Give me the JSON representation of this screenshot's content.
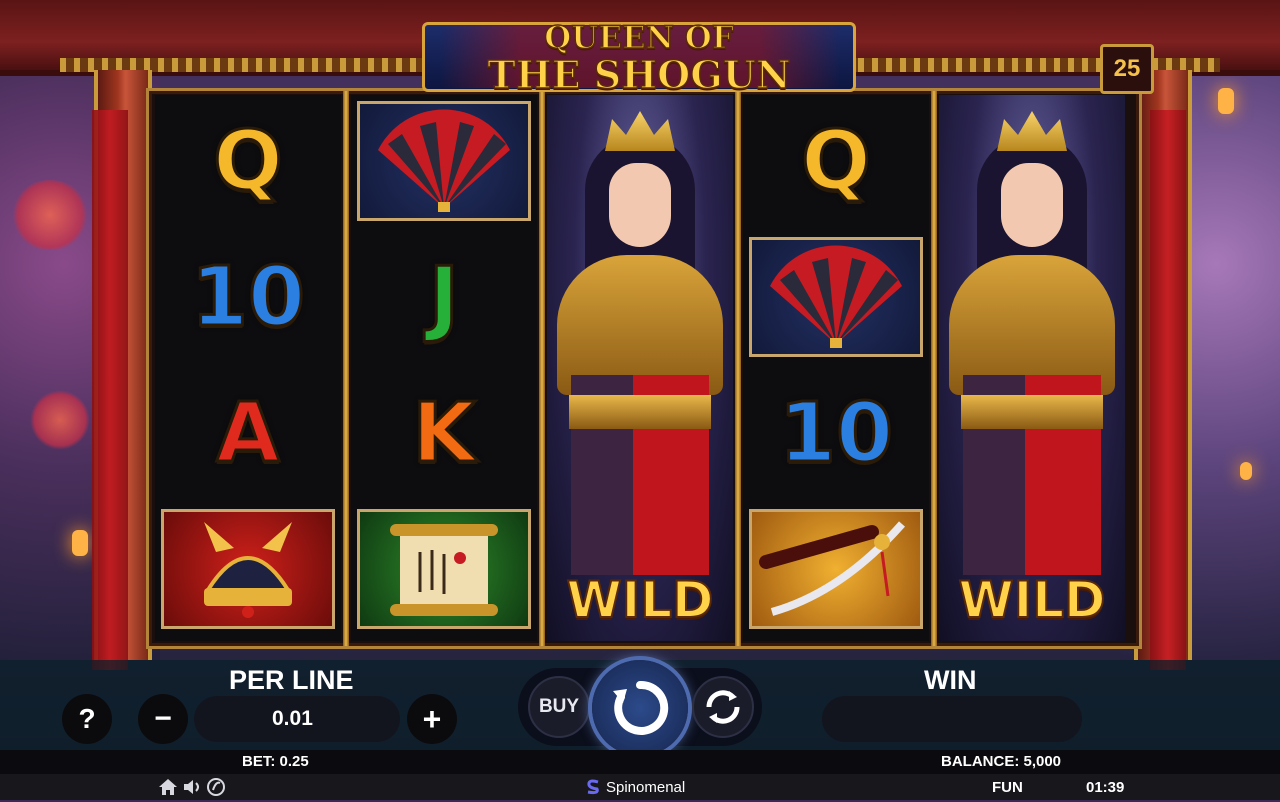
{
  "game": {
    "title_line1": "QUEEN OF",
    "title_line2": "THE SHOGUN",
    "lines_count": "25"
  },
  "reels": [
    [
      "Q",
      "10",
      "A",
      "samurai-helmet"
    ],
    [
      "fan",
      "J",
      "K",
      "scroll"
    ],
    [
      "queen-wild"
    ],
    [
      "Q",
      "fan",
      "10",
      "sword"
    ],
    [
      "queen-wild"
    ]
  ],
  "wild_label": "WILD",
  "controls": {
    "help_label": "?",
    "per_line_label": "PER LINE",
    "per_line_value": "0.01",
    "minus_label": "−",
    "plus_label": "+",
    "buy_label": "BUY",
    "win_label": "WIN",
    "win_value": ""
  },
  "status": {
    "bet_text": "BET: 0.25",
    "balance_text": "BALANCE: 5,000"
  },
  "footer": {
    "brand": "Spinomenal",
    "mode": "FUN",
    "clock": "01:39",
    "icons": [
      "home-icon",
      "sound-icon",
      "turbo-icon"
    ]
  },
  "colors": {
    "gold": "#ffd24a",
    "frame_red": "#7d2020",
    "spin_blue": "#2c4a8a"
  }
}
